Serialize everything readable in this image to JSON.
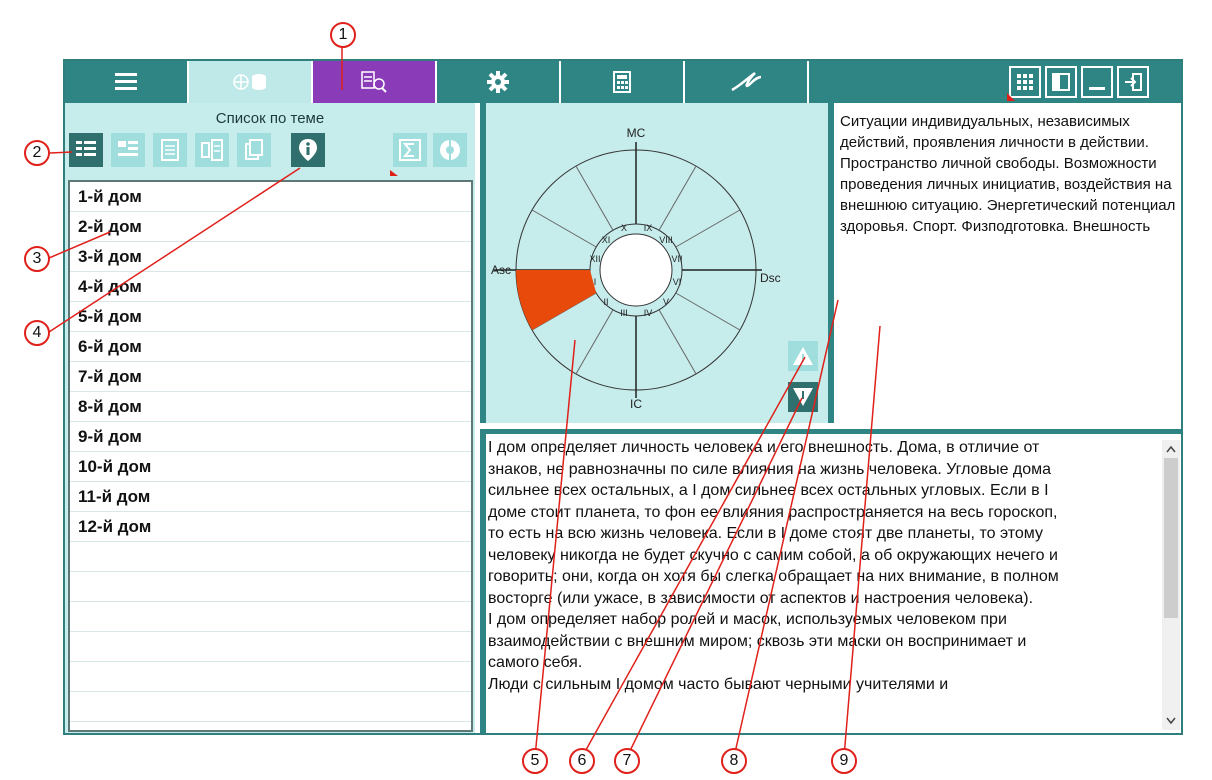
{
  "toolbar": {
    "icons": [
      "menu-icon",
      "globe-database-icon",
      "list-search-icon",
      "gear-icon",
      "calculator-icon",
      "signature-icon",
      "grid-icon",
      "panel-icon",
      "minimize-icon",
      "exit-icon"
    ]
  },
  "left": {
    "title": "Список по теме",
    "items": [
      "1-й дом",
      "2-й дом",
      "3-й дом",
      "4-й дом",
      "5-й дом",
      "6-й дом",
      "7-й дом",
      "8-й дом",
      "9-й дом",
      "10-й дом",
      "11-й дом",
      "12-й дом"
    ]
  },
  "wheel": {
    "mc": "MC",
    "ic": "IC",
    "asc": "Asc",
    "dsc": "Dsc",
    "houses": [
      "I",
      "II",
      "III",
      "IV",
      "V",
      "VI",
      "VII",
      "VIII",
      "IX",
      "X",
      "XI",
      "XII"
    ],
    "highlight_color": "#e84a0c"
  },
  "description": "Ситуации индивидуальных, независимых действий, проявления личности в действии. Пространство личной свободы. Возможности проведения личных инициатив, воздействия на внешнюю ситуацию. Энергетический потенциал здоровья. Спорт. Физподготовка. Внешность",
  "body_lines": [
    "I дом определяет личность человека и его внешность. Дома, в отличие от",
    "знаков, не равнозначны по силе влияния на жизнь человека. Угловые дома",
    "сильнее всех остальных, а I дом сильнее всех остальных угловых. Если в I",
    "доме стоит планета, то фон ее влияния распространяется на весь гороскоп,",
    "то есть на всю жизнь человека. Если в I доме стоят две планеты, то этому",
    "человеку никогда не будет скучно с самим собой, а об окружающих нечего и",
    "говорить; они, когда он хотя бы слегка обращает на них внимание, в полном",
    "восторге (или ужасе, в зависимости от аспектов и настроения человека).",
    "I дом определяет набор ролей и масок, используемых человеком при",
    "взаимодействии с внешним миром; сквозь эти маски он воспринимает и",
    "самого себя.",
    "Люди с сильным I домом часто бывают черными учителями и"
  ],
  "callouts": [
    "1",
    "2",
    "3",
    "4",
    "5",
    "6",
    "7",
    "8",
    "9"
  ],
  "colors": {
    "teal": "#2f8584",
    "light_teal": "#c6eceb",
    "purple": "#8a3bb8",
    "callout_red": "#e0201a"
  }
}
